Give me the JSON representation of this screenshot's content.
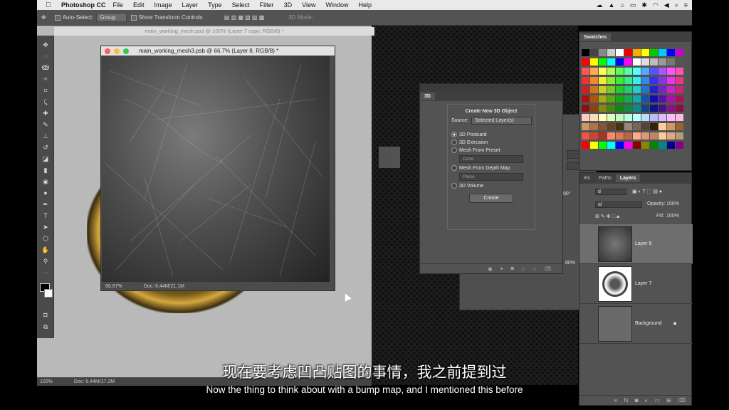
{
  "menubar": {
    "app_name": "Photoshop CC",
    "items": [
      "File",
      "Edit",
      "Image",
      "Layer",
      "Type",
      "Select",
      "Filter",
      "3D",
      "View",
      "Window",
      "Help"
    ]
  },
  "options_bar": {
    "auto_select_label": "Auto-Select:",
    "auto_select_value": "Group",
    "show_transform_label": "Show Transform Controls",
    "mode_label": "3D Mode:"
  },
  "documents": {
    "back_title": "main_working_mesh.psd @ 100% (Layer 7 copy, RGB/8) *",
    "front_title": "main_working_mesh3.psb @ 66.7% (Layer 8, RGB/8) *",
    "front_zoom": "66.67%",
    "front_doc": "Doc: 6.44M/21.1M",
    "back_zoom": "100%",
    "back_doc": "Doc: 6.44M/17.2M"
  },
  "panel_3d": {
    "tab": "3D",
    "heading": "Create New 3D Object",
    "source_label": "Source:",
    "source_value": "Selected Layer(s)",
    "options": [
      "3D Postcard",
      "3D Extrusion",
      "Mesh From Preset",
      "Mesh From Depth Map",
      "3D Volume"
    ],
    "selected_option": "3D Postcard",
    "preset_value": "Cone",
    "depth_value": "Plane",
    "create_label": "Create"
  },
  "behind_panel": {
    "angle": "90°",
    "percent": "80%"
  },
  "swatches": {
    "tab": "Swatches"
  },
  "layers_panel": {
    "tabs": [
      "els",
      "Paths",
      "Layers"
    ],
    "active_tab": "Layers",
    "kind": "d",
    "blend": "al",
    "opacity_label": "Opacity:",
    "opacity_value": "100%",
    "fill_label": "Fill:",
    "fill_value": "100%",
    "layers": [
      {
        "name": "Layer 8",
        "selected": true
      },
      {
        "name": "Layer 7",
        "selected": false
      },
      {
        "name": "Background",
        "selected": false
      }
    ]
  },
  "subtitles": {
    "chinese": "现在要考虑凹凸贴图的事情，我之前提到过",
    "english": "Now the thing to think about with a bump map, and I mentioned this before"
  },
  "colors": {
    "accent_selected": "#6e6e6e",
    "panel_bg": "#535353"
  }
}
